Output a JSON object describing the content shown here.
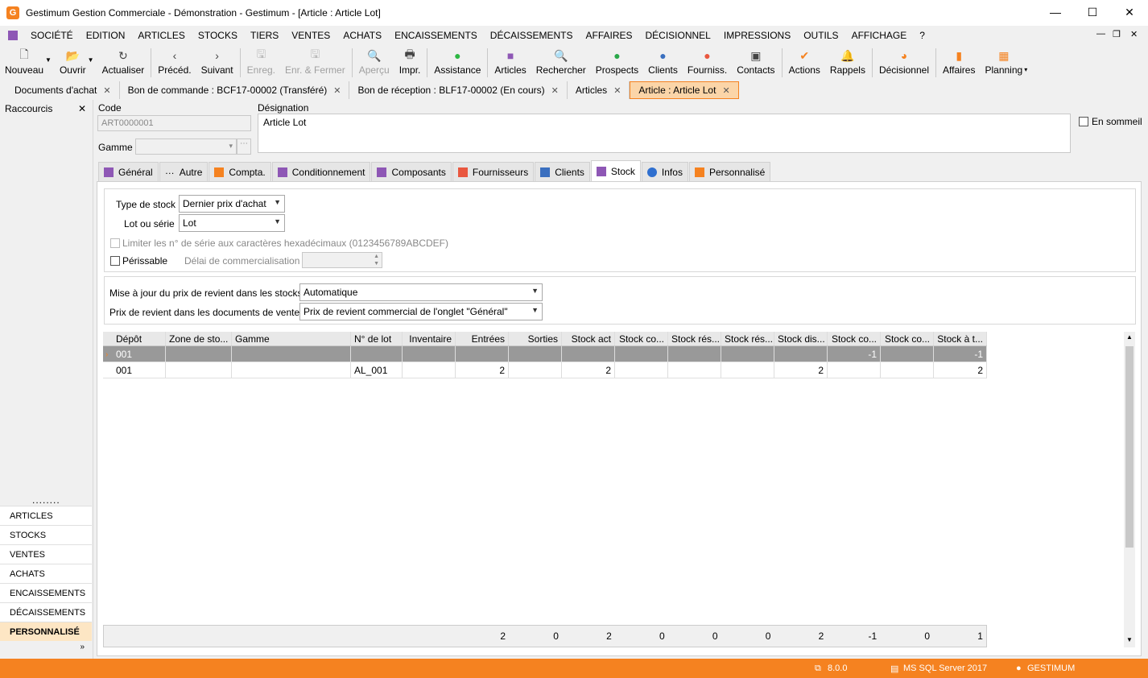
{
  "window": {
    "title": "Gestimum Gestion Commerciale - Démonstration - Gestimum - [Article : Article Lot]"
  },
  "menu": [
    "SOCIÉTÉ",
    "EDITION",
    "ARTICLES",
    "STOCKS",
    "TIERS",
    "VENTES",
    "ACHATS",
    "ENCAISSEMENTS",
    "DÉCAISSEMENTS",
    "AFFAIRES",
    "DÉCISIONNEL",
    "IMPRESSIONS",
    "OUTILS",
    "AFFICHAGE",
    "?"
  ],
  "toolbar": [
    {
      "label": "Nouveau",
      "icon": "new-document-icon",
      "glyph": "🗋",
      "disabled": false
    },
    {
      "label": "Ouvrir",
      "icon": "folder-open-icon",
      "glyph": "📂",
      "disabled": false
    },
    {
      "label": "Actualiser",
      "icon": "refresh-icon",
      "glyph": "↻",
      "disabled": false
    },
    {
      "label": "Précéd.",
      "icon": "chevron-left-icon",
      "glyph": "‹",
      "disabled": false
    },
    {
      "label": "Suivant",
      "icon": "chevron-right-icon",
      "glyph": "›",
      "disabled": false
    },
    {
      "label": "Enreg.",
      "icon": "save-icon",
      "glyph": "🖫",
      "disabled": true
    },
    {
      "label": "Enr. & Fermer",
      "icon": "save-close-icon",
      "glyph": "🖫",
      "disabled": true
    },
    {
      "label": "Aperçu",
      "icon": "preview-icon",
      "glyph": "🔍",
      "disabled": true
    },
    {
      "label": "Impr.",
      "icon": "print-icon",
      "glyph": "🖶",
      "disabled": false
    },
    {
      "label": "Assistance",
      "icon": "whatsapp-icon",
      "glyph": "●",
      "disabled": false
    },
    {
      "label": "Articles",
      "icon": "articles-icon",
      "glyph": "■",
      "disabled": false
    },
    {
      "label": "Rechercher",
      "icon": "search-icon",
      "glyph": "🔍",
      "disabled": false
    },
    {
      "label": "Prospects",
      "icon": "prospects-icon",
      "glyph": "●",
      "disabled": false
    },
    {
      "label": "Clients",
      "icon": "clients-icon",
      "glyph": "●",
      "disabled": false
    },
    {
      "label": "Fourniss.",
      "icon": "suppliers-icon",
      "glyph": "●",
      "disabled": false
    },
    {
      "label": "Contacts",
      "icon": "contacts-icon",
      "glyph": "▣",
      "disabled": false
    },
    {
      "label": "Actions",
      "icon": "actions-icon",
      "glyph": "✔",
      "disabled": false
    },
    {
      "label": "Rappels",
      "icon": "bell-icon",
      "glyph": "🔔",
      "disabled": false
    },
    {
      "label": "Décisionnel",
      "icon": "pie-chart-icon",
      "glyph": "◕",
      "disabled": false
    },
    {
      "label": "Affaires",
      "icon": "bar-chart-icon",
      "glyph": "▮",
      "disabled": false
    },
    {
      "label": "Planning",
      "icon": "calendar-icon",
      "glyph": "▦",
      "disabled": false
    }
  ],
  "tabs": [
    {
      "label": "Documents d'achat",
      "active": false
    },
    {
      "label": "Bon de commande : BCF17-00002 (Transféré)",
      "active": false
    },
    {
      "label": "Bon de réception : BLF17-00002 (En cours)",
      "active": false
    },
    {
      "label": "Articles",
      "active": false
    },
    {
      "label": "Article : Article Lot",
      "active": true
    }
  ],
  "sidebar": {
    "title": "Raccourcis",
    "items": [
      "ARTICLES",
      "STOCKS",
      "VENTES",
      "ACHATS",
      "ENCAISSEMENTS",
      "DÉCAISSEMENTS",
      "PERSONNALISÉ"
    ],
    "active": "PERSONNALISÉ"
  },
  "form": {
    "code_label": "Code",
    "code_value": "ART0000001",
    "gamme_label": "Gamme",
    "designation_label": "Désignation",
    "designation_value": "Article Lot",
    "en_sommeil": "En sommeil"
  },
  "itabs": [
    {
      "label": "Général",
      "color": "#8e57b5"
    },
    {
      "label": "Autre",
      "color": "#555"
    },
    {
      "label": "Compta.",
      "color": "#f58220"
    },
    {
      "label": "Conditionnement",
      "color": "#8e57b5"
    },
    {
      "label": "Composants",
      "color": "#8e57b5"
    },
    {
      "label": "Fournisseurs",
      "color": "#e9573f"
    },
    {
      "label": "Clients",
      "color": "#3a6fbf"
    },
    {
      "label": "Stock",
      "color": "#8e57b5"
    },
    {
      "label": "Infos",
      "color": "#2f6fcf"
    },
    {
      "label": "Personnalisé",
      "color": "#f58220"
    }
  ],
  "stock": {
    "type_label": "Type de stock",
    "type_value": "Dernier prix d'achat",
    "lot_label": "Lot ou série",
    "lot_value": "Lot",
    "hex_label": "Limiter les n° de série aux caractères hexadécimaux (0123456789ABCDEF)",
    "perissable_label": "Périssable",
    "delai_label": "Délai de commercialisation",
    "maj_label": "Mise à jour du prix de revient dans les stocks",
    "maj_value": "Automatique",
    "prix_label": "Prix de revient dans les documents de vente",
    "prix_value": "Prix de revient commercial de l'onglet \"Général\""
  },
  "grid": {
    "columns": [
      "Dépôt",
      "Zone de sto...",
      "Gamme",
      "N° de lot",
      "Inventaire",
      "Entrées",
      "Sorties",
      "Stock act",
      "Stock co...",
      "Stock rés...",
      "Stock rés...",
      "Stock dis...",
      "Stock co...",
      "Stock co...",
      "Stock à t..."
    ],
    "rows": [
      [
        "001",
        "",
        "",
        "",
        "",
        "",
        "",
        "",
        "",
        "",
        "",
        "",
        "-1",
        "",
        "-1"
      ],
      [
        "001",
        "",
        "",
        "AL_001",
        "",
        "2",
        "",
        "2",
        "",
        "",
        "",
        "2",
        "",
        "",
        "2"
      ]
    ],
    "totals": [
      "",
      "",
      "",
      "",
      "",
      "2",
      "0",
      "2",
      "0",
      "0",
      "0",
      "2",
      "-1",
      "0",
      "1"
    ]
  },
  "status": {
    "version": "8.0.0",
    "db": "MS SQL Server 2017",
    "user": "GESTIMUM"
  }
}
